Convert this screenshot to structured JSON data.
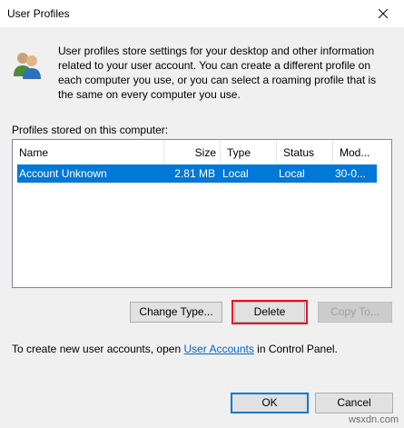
{
  "window": {
    "title": "User Profiles",
    "close_icon": "close-icon"
  },
  "description": "User profiles store settings for your desktop and other information related to your user account. You can create a different profile on each computer you use, or you can select a roaming profile that is the same on every computer you use.",
  "profiles_label": "Profiles stored on this computer:",
  "table": {
    "columns": [
      "Name",
      "Size",
      "Type",
      "Status",
      "Mod..."
    ],
    "rows": [
      {
        "name": "Account Unknown",
        "size": "2.81 MB",
        "type": "Local",
        "status": "Local",
        "modified": "30-0...",
        "selected": true
      }
    ]
  },
  "buttons": {
    "change_type": "Change Type...",
    "delete": "Delete",
    "copy_to": "Copy To...",
    "ok": "OK",
    "cancel": "Cancel"
  },
  "footer": {
    "prefix": "To create new user accounts, open ",
    "link": "User Accounts",
    "suffix": " in Control Panel."
  },
  "watermark": "wsxdn.com",
  "colors": {
    "selection": "#0078d7",
    "highlight_border": "#e81123",
    "link": "#0066cc"
  }
}
